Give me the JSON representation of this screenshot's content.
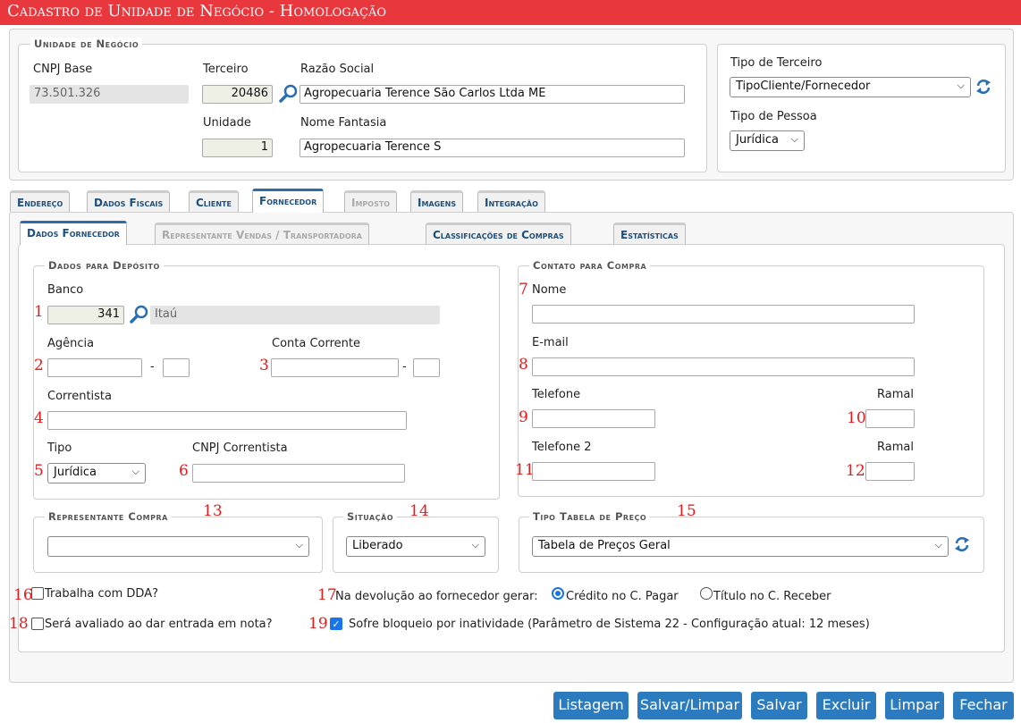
{
  "title": "Cadastro de Unidade de Negócio  - Homologação",
  "unidade": {
    "legend": "Unidade de Negócio",
    "cnpj_label": "CNPJ Base",
    "cnpj_value": "73.501.326",
    "terceiro_label": "Terceiro",
    "terceiro_value": "20486",
    "razao_label": "Razão Social",
    "razao_value": "Agropecuaria Terence São Carlos Ltda ME",
    "unidade_label": "Unidade",
    "unidade_value": "1",
    "fantasia_label": "Nome Fantasia",
    "fantasia_value": "Agropecuaria Terence S"
  },
  "tipo": {
    "terceiro_label": "Tipo de Terceiro",
    "terceiro_value": "TipoCliente/Fornecedor",
    "pessoa_label": "Tipo de Pessoa",
    "pessoa_value": "Jurídica"
  },
  "main_tabs": [
    "Endereço",
    "Dados Fiscais",
    "Cliente",
    "Fornecedor",
    "Imposto",
    "Imagens",
    "Integração"
  ],
  "sub_tabs": [
    "Dados Fornecedor",
    "Representante Vendas / Transportadora",
    "Classificações de Compras",
    "Estatísticas"
  ],
  "deposito": {
    "legend": "Dados para Depósito",
    "banco_label": "Banco",
    "banco_code": "341",
    "banco_name": "Itaú",
    "agencia_label": "Agência",
    "conta_label": "Conta Corrente",
    "dash": "-",
    "correntista_label": "Correntista",
    "tipo_label": "Tipo",
    "tipo_value": "Jurídica",
    "cnpj_corr_label": "CNPJ Correntista"
  },
  "contato": {
    "legend": "Contato para Compra",
    "nome_label": "Nome",
    "email_label": "E-mail",
    "telefone_label": "Telefone",
    "ramal_label": "Ramal",
    "telefone2_label": "Telefone 2",
    "ramal2_label": "Ramal"
  },
  "representante": {
    "legend": "Representante Compra",
    "value": ""
  },
  "situacao": {
    "legend": "Situação",
    "value": "Liberado"
  },
  "tabela": {
    "legend": "Tipo Tabela de Preço",
    "value": "Tabela de Preços Geral"
  },
  "options": {
    "dda": "Trabalha com DDA?",
    "avaliado": "Será avaliado ao dar entrada em nota?",
    "devolucao_label": "Na devolução ao fornecedor gerar:",
    "credito": "Crédito no C. Pagar",
    "titulo": "Título no C. Receber",
    "bloqueio": "Sofre bloqueio por inatividade (Parâmetro de Sistema 22 - Configuração atual: 12 meses)"
  },
  "markers": [
    "1",
    "2",
    "3",
    "4",
    "5",
    "6",
    "7",
    "8",
    "9",
    "10",
    "11",
    "12",
    "13",
    "14",
    "15",
    "16",
    "17",
    "18",
    "19"
  ],
  "buttons": [
    "Listagem",
    "Salvar/Limpar",
    "Salvar",
    "Excluir",
    "Limpar",
    "Fechar"
  ],
  "colors": {
    "titlebar": "#e8383e",
    "button": "#2c7bbf",
    "tab_active": "#2c6fa8",
    "marker": "#e21b1b"
  }
}
